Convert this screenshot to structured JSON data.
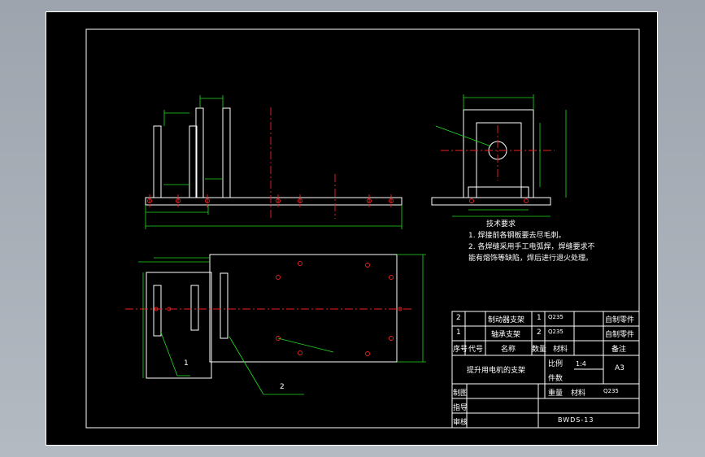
{
  "notes": {
    "title": "技术要求",
    "line1": "1. 焊接前各钢板要去尽毛刺。",
    "line2": "2. 各焊缝采用手工电弧焊，焊缝要求不",
    "line3": "能有熔饰等缺陷，焊后进行退火处理。"
  },
  "callouts": {
    "c1": "1",
    "c2": "2"
  },
  "bom": {
    "rows": [
      {
        "no": "2",
        "name": "制动器支架",
        "qty": "1",
        "material": "Q235",
        "remark": "自制零件"
      },
      {
        "no": "1",
        "name": "轴承支架",
        "qty": "2",
        "material": "Q235",
        "remark": "自制零件"
      }
    ],
    "headers": {
      "no": "序号",
      "code": "代号",
      "name": "名称",
      "qty": "数量",
      "material": "材料",
      "remark": "备注"
    }
  },
  "titleblock": {
    "part_name": "提升用电机的支架",
    "scale_label": "比例",
    "scale_value": "1:4",
    "count_label": "件数",
    "sheet_size": "A3",
    "weight_label": "重量",
    "material_label": "材料",
    "material_value": "Q235",
    "drawn_by": "制图",
    "designed_by": "指导",
    "checked_by": "审核",
    "drawing_no": "BWDS-13"
  }
}
